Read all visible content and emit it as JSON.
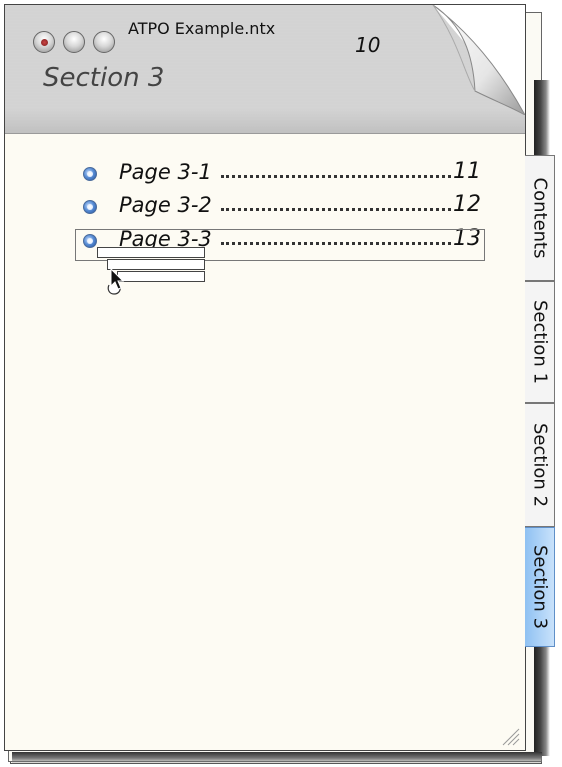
{
  "window": {
    "title": "ATPO Example.ntx",
    "header_page_number": "10",
    "section_title": "Section 3"
  },
  "toc": {
    "entries": [
      {
        "label": "Page 3-1",
        "page": "11"
      },
      {
        "label": "Page 3-2",
        "page": "12"
      },
      {
        "label": "Page 3-3",
        "page": "13"
      }
    ]
  },
  "tabs": [
    {
      "label": "Contents",
      "active": false
    },
    {
      "label": "Section 1",
      "active": false
    },
    {
      "label": "Section 2",
      "active": false
    },
    {
      "label": "Section 3",
      "active": true
    }
  ],
  "icons": {
    "close": "close-button-icon",
    "minimize": "minimize-button-icon",
    "zoom": "zoom-button-icon",
    "bullet": "radio-bullet-icon",
    "cursor": "drag-cursor-icon",
    "resize": "resize-grip-icon",
    "page_curl": "page-curl-icon"
  },
  "colors": {
    "paper": "#fdfbf3",
    "active_tab": "#a9d0f7",
    "bullet": "#4a7fc8"
  }
}
